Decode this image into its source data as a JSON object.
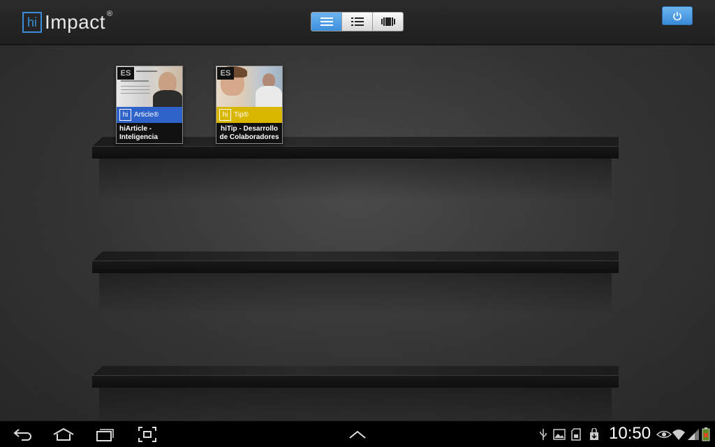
{
  "header": {
    "logo_hi": "hi",
    "logo_name": "Impact",
    "logo_reg": "®",
    "view_modes": [
      {
        "name": "shelf",
        "icon": "shelf-view-icon",
        "active": true
      },
      {
        "name": "list",
        "icon": "list-view-icon",
        "active": false
      },
      {
        "name": "coverflow",
        "icon": "coverflow-view-icon",
        "active": false
      }
    ],
    "power_icon": "power-icon",
    "accent": "#3a8fd8"
  },
  "books": [
    {
      "lang": "ES",
      "band_hi": "hi",
      "type": "Article®",
      "title": "hiArticle - Inteligencia",
      "band_color": "#2e63c9"
    },
    {
      "lang": "ES",
      "band_hi": "hi",
      "type": "Tip®",
      "title": "hiTip - Desarrollo de Colaboradores",
      "band_color": "#d9b600"
    }
  ],
  "system_bar": {
    "clock": "10:50",
    "nav_icons": [
      "back-icon",
      "home-icon",
      "recent-apps-icon",
      "screenshot-icon",
      "up-chevron-icon"
    ],
    "status_icons": [
      "usb-icon",
      "gallery-icon",
      "sd-card-icon",
      "download-icon",
      "eye-icon",
      "wifi-icon",
      "signal-icon",
      "battery-icon"
    ]
  }
}
